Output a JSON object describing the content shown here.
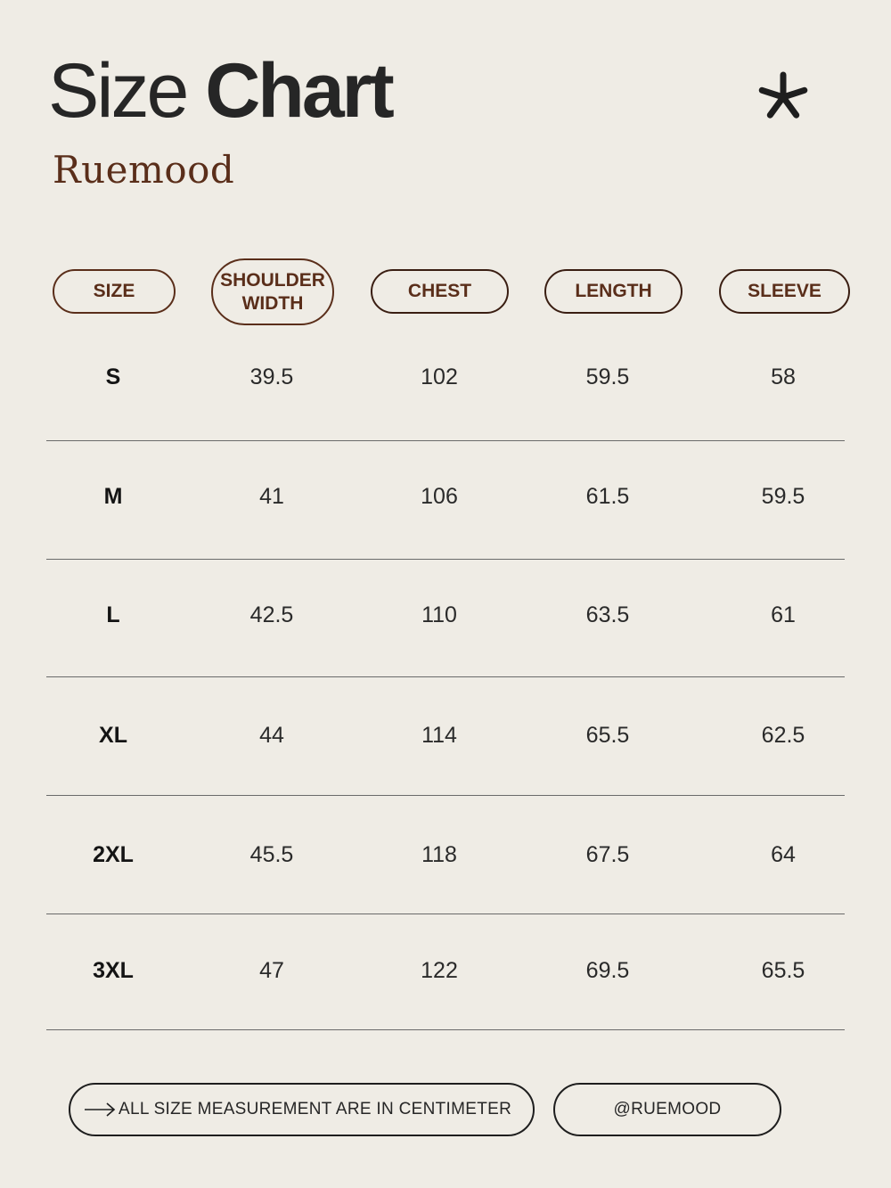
{
  "header": {
    "title_light": "Size",
    "title_bold": "Chart",
    "brand": "Ruemood",
    "decoration_icon": "asterisk-icon"
  },
  "columns": [
    "SIZE",
    "SHOULDER WIDTH",
    "CHEST",
    "LENGTH",
    "SLEEVE"
  ],
  "rows": [
    {
      "size": "S",
      "shoulder": "39.5",
      "chest": "102",
      "length": "59.5",
      "sleeve": "58"
    },
    {
      "size": "M",
      "shoulder": "41",
      "chest": "106",
      "length": "61.5",
      "sleeve": "59.5"
    },
    {
      "size": "L",
      "shoulder": "42.5",
      "chest": "110",
      "length": "63.5",
      "sleeve": "61"
    },
    {
      "size": "XL",
      "shoulder": "44",
      "chest": "114",
      "length": "65.5",
      "sleeve": "62.5"
    },
    {
      "size": "2XL",
      "shoulder": "45.5",
      "chest": "118",
      "length": "67.5",
      "sleeve": "64"
    },
    {
      "size": "3XL",
      "shoulder": "47",
      "chest": "122",
      "length": "69.5",
      "sleeve": "65.5"
    }
  ],
  "footer": {
    "note": "ALL SIZE MEASUREMENT ARE IN CENTIMETER",
    "note_icon": "arrow-right-icon",
    "handle": "@RUEMOOD"
  },
  "colors": {
    "background": "#efece5",
    "accent_brown": "#5a2e1a",
    "text_dark": "#1e1e1e",
    "rule": "#6a6a6a"
  }
}
